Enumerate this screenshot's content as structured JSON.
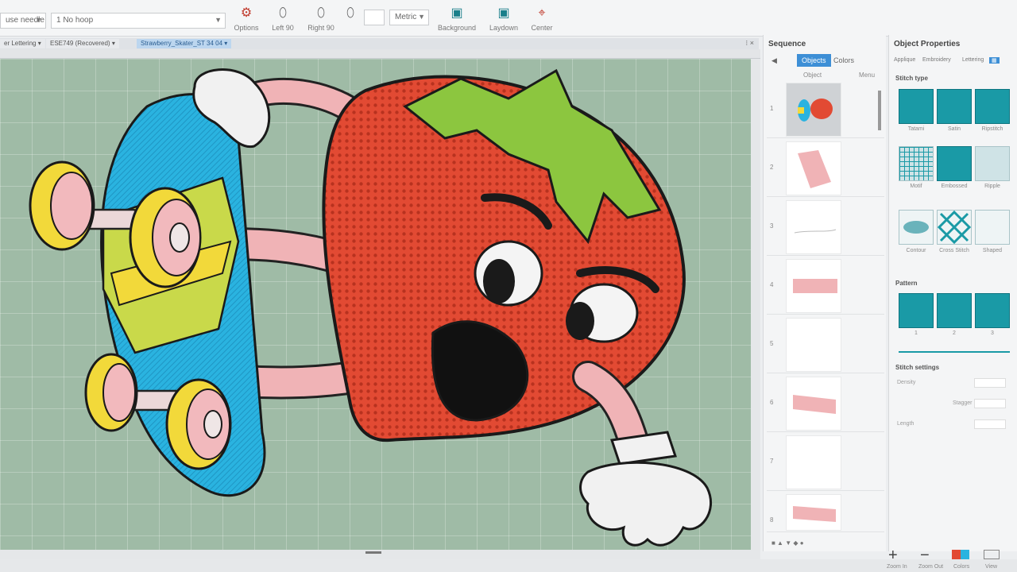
{
  "toolbar": {
    "needle_combo": "use needle",
    "hoop_combo": "1 No hoop",
    "options_label": "Options",
    "left_label": "Left 90",
    "right_label": "Right 90",
    "units_combo": "Metric",
    "background_label": "Background",
    "laydown_label": "Laydown",
    "center_label": "Center"
  },
  "tabs": [
    {
      "label": "er Lettering"
    },
    {
      "label": "ESE749 (Recovered)"
    },
    {
      "label": "Strawberry_Skater_ST 34 04"
    }
  ],
  "sequence": {
    "title": "Sequence",
    "tab_objects": "Objects",
    "tab_colors": "Colors",
    "col_object": "Object",
    "col_info": "Menu",
    "items": [
      {
        "num": "1"
      },
      {
        "num": "2"
      },
      {
        "num": "3"
      },
      {
        "num": "4"
      },
      {
        "num": "5"
      },
      {
        "num": "6"
      },
      {
        "num": "7"
      },
      {
        "num": "8"
      }
    ]
  },
  "properties": {
    "title": "Object Properties",
    "tab_a": "Applique",
    "tab_b": "Embroidery",
    "tab_c": "Lettering",
    "stitch_type_label": "Stitch type",
    "stitch_types": [
      "Tatami",
      "Satin",
      "Ripstitch",
      "Motif",
      "Embossed",
      "Ripple",
      "Contour",
      "Cross Stitch",
      "Shaped"
    ],
    "pattern_label": "Pattern",
    "pattern_values": [
      "1",
      "2",
      "3"
    ],
    "stitch_settings_label": "Stitch settings",
    "row_density": "Density",
    "row_stagger": "Stagger",
    "row_length": "Length"
  },
  "bottom": {
    "zoom_in": "Zoom In",
    "zoom_out": "Zoom Out",
    "colors": "Colors",
    "view": "View"
  },
  "colors": {
    "accent": "#3d8fd6",
    "teal": "#1a9aa6",
    "canvas": "#9fbba6",
    "strawberry": "#e24a33",
    "leaf": "#8cc63f",
    "skateboard": "#2ab3e0",
    "wheel": "#f2d93a"
  }
}
